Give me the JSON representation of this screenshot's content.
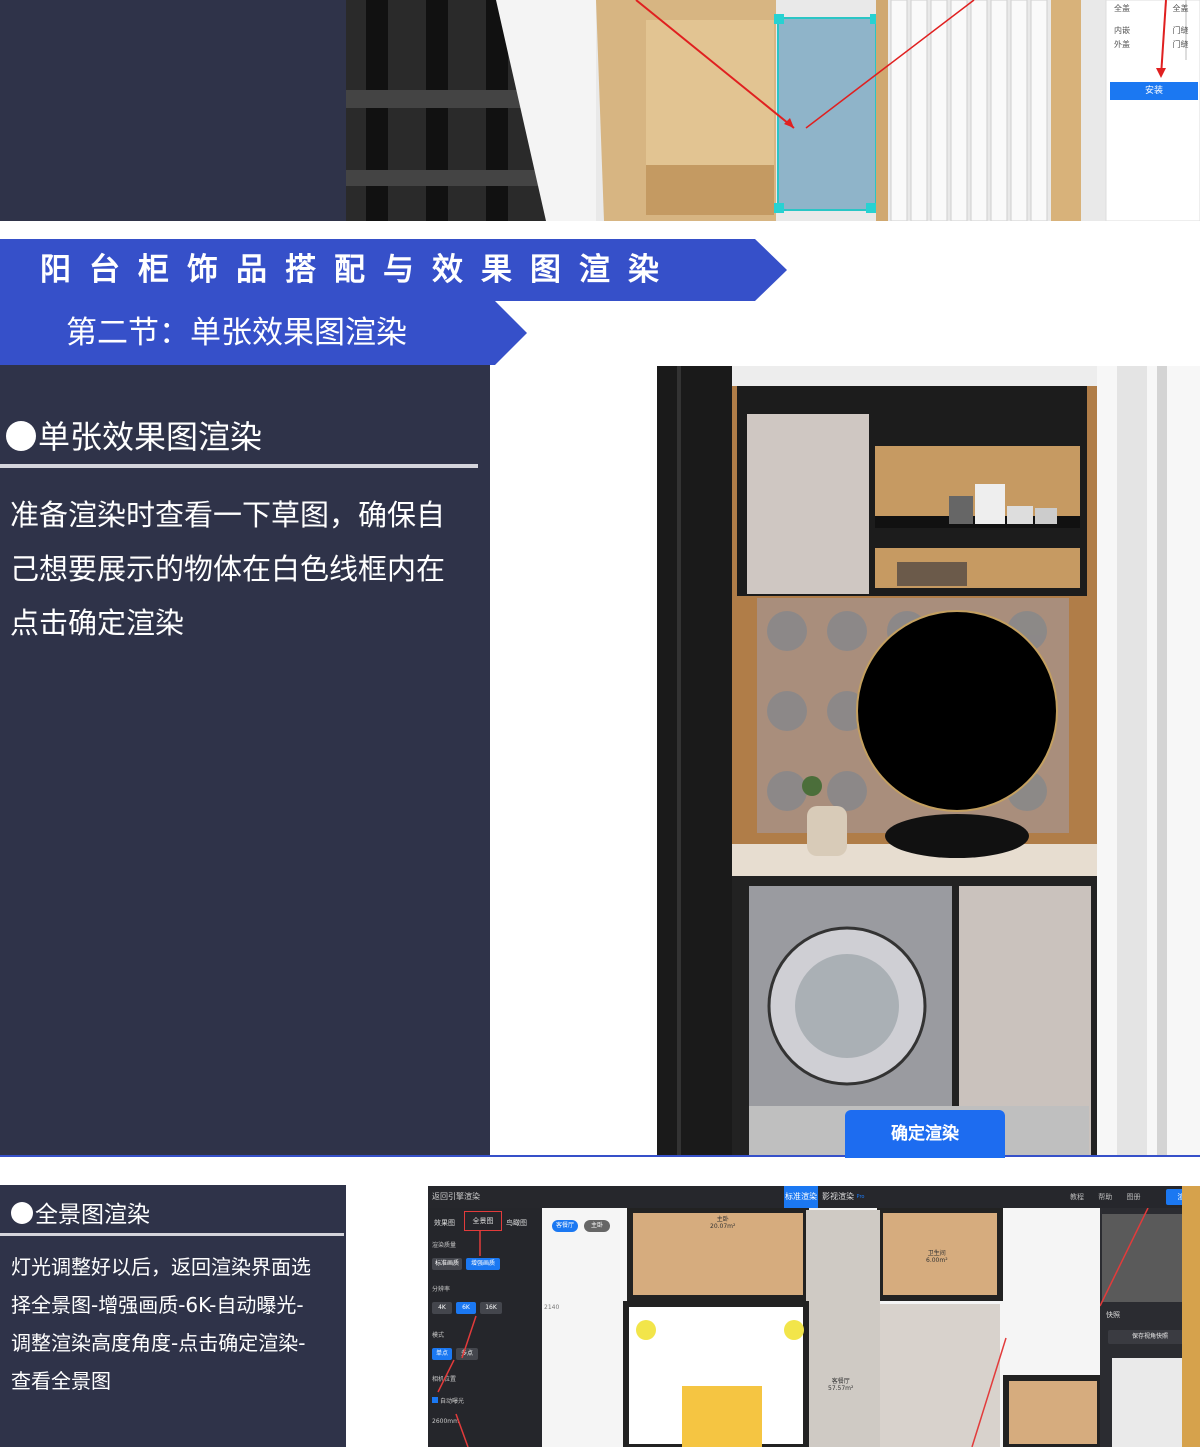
{
  "top_screenshot": {
    "panel_rows": [
      "全盖",
      "全盖",
      "内嵌",
      "门缝",
      "外盖",
      "门缝"
    ],
    "install_button": "安装"
  },
  "banner": {
    "title": "阳台柜饰品搭配与效果图渲染",
    "subtitle": "第二节：单张效果图渲染"
  },
  "section1": {
    "heading": "单张效果图渲染",
    "body_lines": [
      "准备渲染时查看一下草图，确保自",
      "己想要展示的物体在白色线框内在",
      "点击确定渲染"
    ]
  },
  "render_view": {
    "confirm_button": "确定渲染"
  },
  "section2": {
    "heading": "全景图渲染",
    "body_lines": [
      "灯光调整好以后，返回渲染界面选",
      "择全景图-增强画质-6K-自动曝光-",
      "调整渲染高度角度-点击确定渲染-",
      "查看全景图"
    ]
  },
  "app": {
    "back_label": "返回引擎渲染",
    "tabs": {
      "standard": "标准渲染",
      "film": "影视渲染",
      "pro_badge": "Pro"
    },
    "header_tools": [
      "教程",
      "帮助",
      "图册"
    ],
    "render_button": "渲",
    "side_tabs": [
      "效果图",
      "全景图",
      "鸟瞰图"
    ],
    "quality_label": "渲染质量",
    "quality_options": [
      "标准画质",
      "增强画质"
    ],
    "resolution_label": "分辨率",
    "resolution_options": [
      "4K",
      "6K",
      "16K"
    ],
    "mode_label": "模式",
    "mode_options": [
      "单点",
      "多点"
    ],
    "camera_label": "相机位置",
    "auto_exposure": "自动曝光",
    "height_value": "2600mm",
    "map_buttons": [
      "客餐厅",
      "主卧"
    ],
    "rooms": [
      {
        "name": "主卧",
        "area": "20.07m²"
      },
      {
        "name": "卫生间",
        "area": "6.00m²"
      },
      {
        "name": "客餐厅",
        "area": "57.57m²"
      }
    ],
    "map_side_text": "2140",
    "quick_view_label": "快照",
    "save_view_button": "保存视角快照"
  },
  "colors": {
    "banner_blue": "#3650c9",
    "panel_navy": "#2f3349",
    "button_blue": "#1d6cf0"
  }
}
